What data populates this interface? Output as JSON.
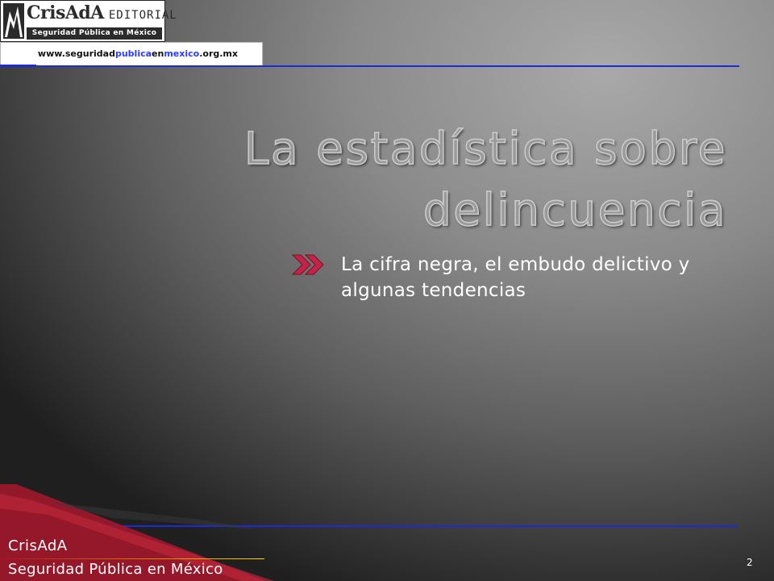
{
  "header": {
    "logo": {
      "brand": "CrisAdA",
      "editorial": "EDITORIAL",
      "subtitle": "Seguridad Pública en México"
    },
    "url": {
      "part1": "www.seguridad",
      "part2": "publica",
      "part3": "en",
      "part4": "mexico",
      "part5": ".org.mx"
    }
  },
  "slide": {
    "title": "La estadística sobre delincuencia",
    "bullet_icon": "double-chevron-right-icon",
    "bullet": "La cifra negra, el embudo delictivo y algunas tendencias"
  },
  "footer": {
    "line1": "CrisAdA",
    "line2": "Seguridad Pública en México",
    "page_number": "2"
  },
  "colors": {
    "rule_blue": "#1b2bd6",
    "url_blue": "#2a3cff",
    "bullet_red": "#c4244a",
    "deco_red": "#a0182b"
  }
}
